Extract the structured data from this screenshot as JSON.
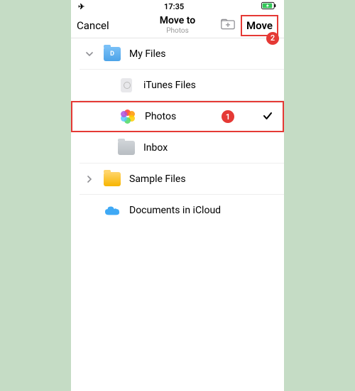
{
  "status": {
    "time": "17:35"
  },
  "nav": {
    "cancel": "Cancel",
    "title": "Move to",
    "subtitle": "Photos",
    "move": "Move",
    "badge2": "2"
  },
  "rows": {
    "myfiles": "My Files",
    "myfiles_badge": "D",
    "itunes": "iTunes Files",
    "photos": "Photos",
    "badge1": "1",
    "inbox": "Inbox",
    "sample": "Sample Files",
    "icloud": "Documents in iCloud"
  }
}
